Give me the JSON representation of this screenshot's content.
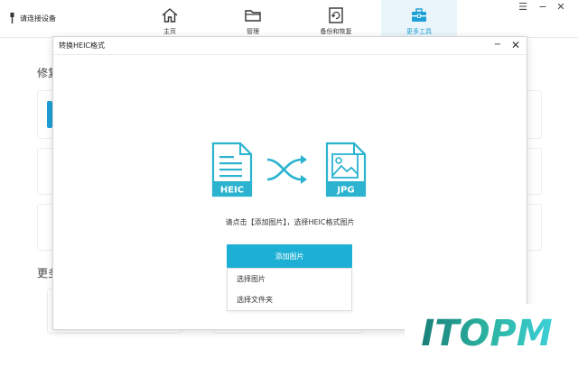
{
  "topbar": {
    "device_label": "请连接设备",
    "tabs": [
      {
        "label": "主页",
        "icon": "home-icon"
      },
      {
        "label": "管理",
        "icon": "folder-icon"
      },
      {
        "label": "备份和恢复",
        "icon": "backup-icon"
      },
      {
        "label": "更多工具",
        "icon": "toolbox-icon"
      }
    ],
    "active_tab": 3,
    "window_controls": {
      "menu": "☰",
      "minimize": "−",
      "close": "✕"
    }
  },
  "background": {
    "heading1": "修复",
    "heading2": "更多"
  },
  "dialog": {
    "title": "转换HEIC格式",
    "minimize": "−",
    "close": "✕",
    "source_format": "HEIC",
    "target_format": "JPG",
    "prompt": "请点击【添加图片】，选择HEIC格式图片",
    "add_button": "添加图片",
    "menu_items": [
      "选择图片",
      "选择文件夹"
    ]
  },
  "watermark": {
    "text": "ITOPM"
  },
  "colors": {
    "accent": "#1eb0d4",
    "tab_active_bg": "#e9f5fb",
    "icon_teal": "#2bb3cf"
  }
}
